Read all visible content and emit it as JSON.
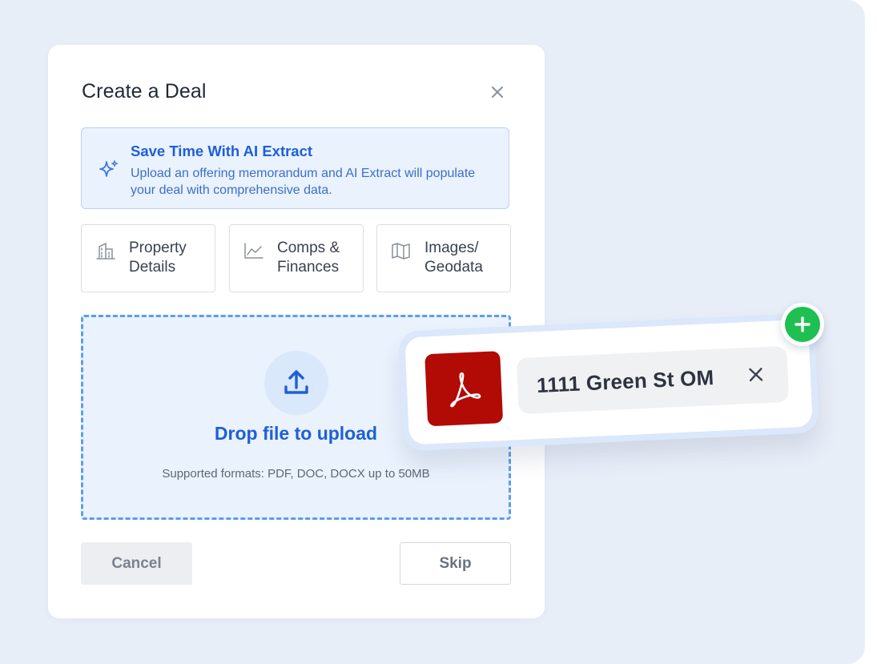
{
  "modal": {
    "title": "Create a Deal",
    "close_icon": "close-icon"
  },
  "banner": {
    "icon": "sparkle-icon",
    "title": "Save Time With AI Extract",
    "text": "Upload an offering memorandum and AI Extract will populate your deal with comprehensive data."
  },
  "tabs": [
    {
      "label": "Property\nDetails",
      "icon": "building-icon"
    },
    {
      "label": "Comps &\nFinances",
      "icon": "line-chart-icon"
    },
    {
      "label": "Images/\nGeodata",
      "icon": "map-icon"
    }
  ],
  "dropzone": {
    "icon": "upload-icon",
    "title": "Drop file to upload",
    "formats": "Supported formats: PDF, DOC, DOCX up to 50MB"
  },
  "buttons": {
    "cancel": "Cancel",
    "skip": "Skip"
  },
  "file": {
    "name": "1111 Green St OM",
    "icon": "pdf-icon",
    "remove_icon": "close-icon",
    "add_icon": "plus-icon"
  },
  "colors": {
    "background": "#e8eef8",
    "accent_blue": "#1e5fd8",
    "pdf_red": "#b20a05",
    "add_green": "#1fbf52"
  }
}
